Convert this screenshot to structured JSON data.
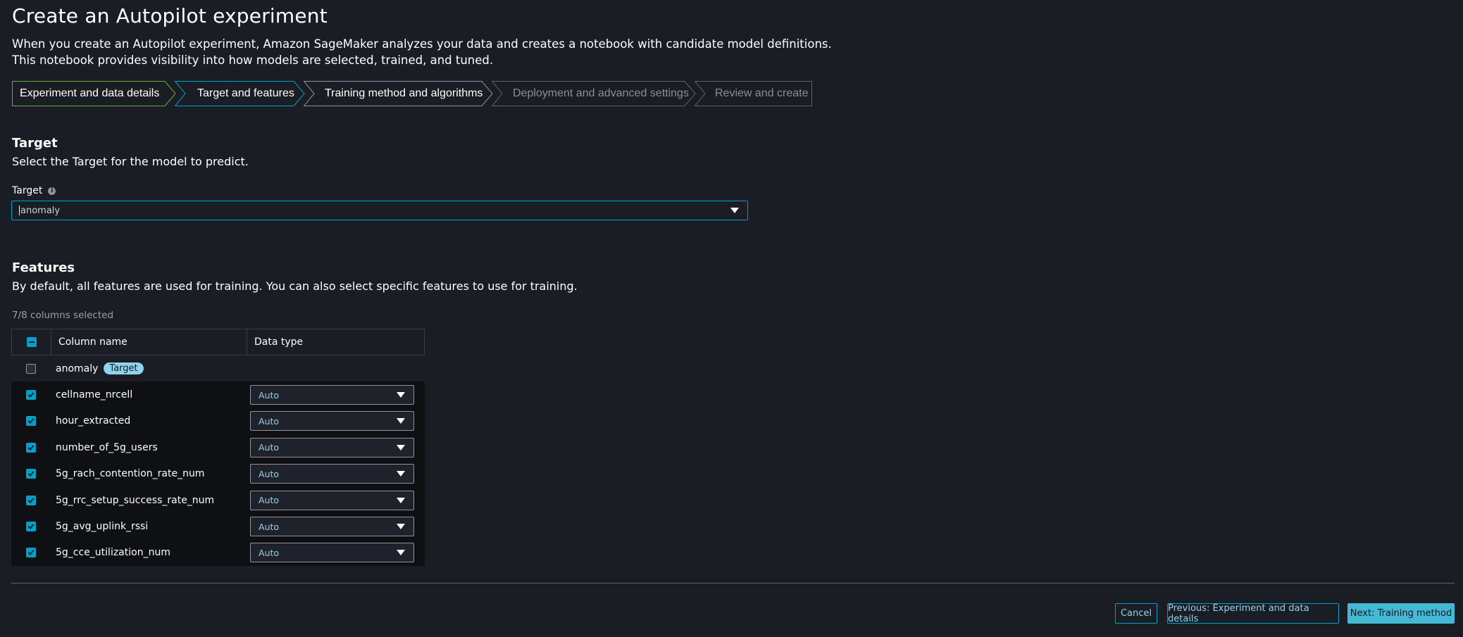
{
  "page": {
    "title": "Create an Autopilot experiment",
    "description_line1": "When you create an Autopilot experiment, Amazon SageMaker analyzes your data and creates a notebook with candidate model definitions.",
    "description_line2": "This notebook provides visibility into how models are selected, trained, and tuned."
  },
  "steps": [
    {
      "label": "Experiment and data details",
      "state": "completed"
    },
    {
      "label": "Target and features",
      "state": "current"
    },
    {
      "label": "Training method and algorithms",
      "state": "upcoming"
    },
    {
      "label": "Deployment and advanced settings",
      "state": "disabled"
    },
    {
      "label": "Review and create",
      "state": "disabled"
    }
  ],
  "target": {
    "heading": "Target",
    "description": "Select the Target for the model to predict.",
    "field_label": "Target",
    "info_icon": "info-icon",
    "value": "anomaly"
  },
  "features": {
    "heading": "Features",
    "description": "By default, all features are used for training. You can also select specific features to use for training.",
    "selected_count": "7/8 columns selected",
    "columns": {
      "name": "Column name",
      "type": "Data type"
    },
    "rows": [
      {
        "name": "anomaly",
        "checked": false,
        "badge": "Target"
      },
      {
        "name": "cellname_nrcell",
        "checked": true,
        "type": "Auto"
      },
      {
        "name": "hour_extracted",
        "checked": true,
        "type": "Auto"
      },
      {
        "name": "number_of_5g_users",
        "checked": true,
        "type": "Auto"
      },
      {
        "name": "5g_rach_contention_rate_num",
        "checked": true,
        "type": "Auto"
      },
      {
        "name": "5g_rrc_setup_success_rate_num",
        "checked": true,
        "type": "Auto"
      },
      {
        "name": "5g_avg_uplink_rssi",
        "checked": true,
        "type": "Auto"
      },
      {
        "name": "5g_cce_utilization_num",
        "checked": true,
        "type": "Auto"
      }
    ]
  },
  "footer": {
    "cancel": "Cancel",
    "previous": "Previous: Experiment and data details",
    "next": "Next: Training method"
  },
  "colors": {
    "background": "#1b1d24",
    "accent": "#00a1c9",
    "completed_step": "#6aaf35",
    "badge": "#8fd4ef"
  }
}
